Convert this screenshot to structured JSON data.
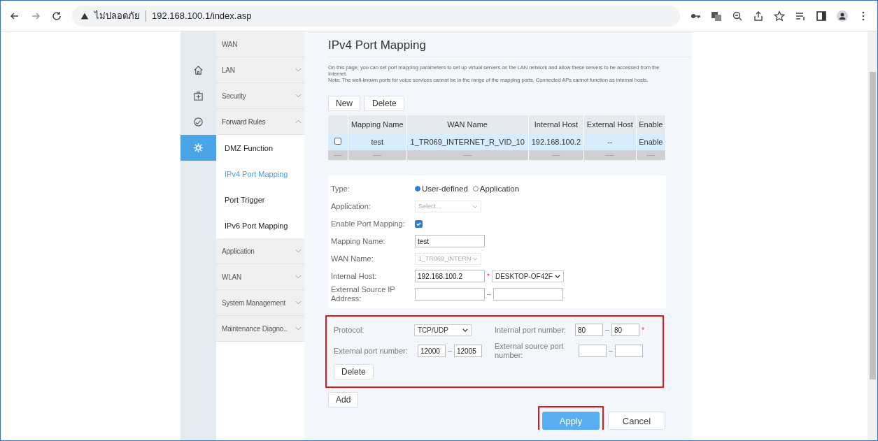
{
  "browser": {
    "security_label": "ไม่ปลอดภัย",
    "url": "192.168.100.1/index.asp"
  },
  "icon_rail": [
    {
      "kind": "home",
      "selected": false
    },
    {
      "kind": "firstaid",
      "selected": false
    },
    {
      "kind": "gauge",
      "selected": false
    },
    {
      "kind": "gear",
      "selected": true
    }
  ],
  "sidebar": {
    "items": [
      {
        "label": "WAN"
      },
      {
        "label": "LAN",
        "expanded": false
      },
      {
        "label": "Security",
        "expanded": false
      },
      {
        "label": "Forward Rules",
        "expanded": true,
        "children": [
          {
            "label": "DMZ Function",
            "selected": false
          },
          {
            "label": "IPv4 Port Mapping",
            "selected": true
          },
          {
            "label": "Port Trigger",
            "selected": false
          },
          {
            "label": "IPv6 Port Mapping",
            "selected": false
          }
        ]
      },
      {
        "label": "Application",
        "expanded": false
      },
      {
        "label": "WLAN",
        "expanded": false
      },
      {
        "label": "System Management",
        "expanded": false
      },
      {
        "label": "Maintenance Diagno..",
        "expanded": false
      }
    ]
  },
  "page": {
    "title": "IPv4 Port Mapping",
    "description": [
      "On this page, you can set port mapping parameters to set up virtual servers on the LAN network and allow these servers to be accessed from the Internet.",
      "Note: The well-known ports for voice services cannot be in the range of the mapping ports. Connected APs cannot function as internal hosts."
    ],
    "buttons": [
      "New",
      "Delete"
    ]
  },
  "table": {
    "columns": [
      "Mapping Name",
      "WAN Name",
      "Internal Host",
      "External Host",
      "Enable"
    ],
    "rows": [
      {
        "kind": "entry",
        "checked": false,
        "cells": [
          "test",
          "1_TR069_INTERNET_R_VID_10",
          "192.168.100.2",
          "--",
          "Enable"
        ]
      },
      {
        "kind": "placeholder",
        "checkbox_cell": "----",
        "cells": [
          "----",
          "----",
          "----",
          "----",
          "----"
        ]
      }
    ]
  },
  "form": {
    "fields": [
      {
        "kind": "radio",
        "label": "Type:",
        "options": [
          {
            "label": "User-defined",
            "selected": true
          },
          {
            "label": "Application",
            "selected": false
          }
        ]
      },
      {
        "kind": "select",
        "label": "Application:",
        "value": "Select...",
        "disabled": true
      },
      {
        "kind": "checkbox",
        "label": "Enable Port Mapping:",
        "checked": true
      },
      {
        "kind": "text",
        "label": "Mapping Name:",
        "value": "test"
      },
      {
        "kind": "select",
        "label": "WAN Name:",
        "value": "1_TR069_INTERN",
        "disabled": true
      },
      {
        "kind": "host",
        "label": "Internal Host:",
        "value": "192.168.100.2",
        "required": "*",
        "device": "DESKTOP-OF42F"
      },
      {
        "kind": "range",
        "label": "External Source IP Address:"
      }
    ]
  },
  "port_rule": {
    "highlighted": true,
    "fields": [
      {
        "kind": "select",
        "label": "Protocol:",
        "value": "TCP/UDP",
        "disabled": false
      },
      {
        "kind": "range",
        "label": "External port number:",
        "from": "12000",
        "to": "12005"
      },
      {
        "kind": "range",
        "label": "Internal port number:",
        "from": "80",
        "to": "80",
        "required": "*"
      },
      {
        "kind": "range",
        "label": "External source port number:"
      }
    ],
    "delete_button": "Delete"
  },
  "add_button": "Add",
  "apply_button": {
    "label": "Apply",
    "highlighted": true
  },
  "cancel_button": "Cancel"
}
